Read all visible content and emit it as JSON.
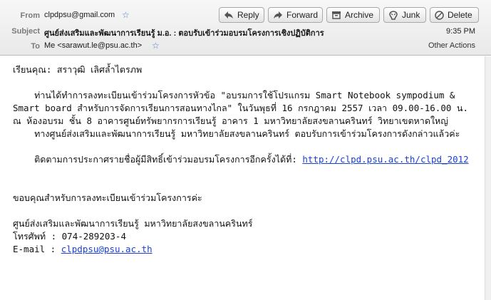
{
  "header": {
    "from_label": "From",
    "from_value": "clpdpsu@gmail.com",
    "subject_label": "Subject",
    "subject_value": "ศูนย์ส่งเสริมและพัฒนาการเรียนรู้ ม.อ. : ตอบรับเข้าร่วมอบรมโครงการเชิงปฏิบัติการ",
    "to_label": "To",
    "to_value": "Me <sarawut.le@psu.ac.th>",
    "time": "9:35 PM",
    "other_actions": "Other Actions"
  },
  "toolbar": {
    "reply": "Reply",
    "forward": "Forward",
    "archive": "Archive",
    "junk": "Junk",
    "delete": "Delete"
  },
  "body": {
    "greeting": "เรียนคุณ: สราวุฒิ เลิศล้ำไตรภพ",
    "para1": "    ท่านได้ทำการลงทะเบียนเข้าร่วมโครงการหัวข้อ \"อบรมการใช้โปรแกรม Smart Notebook sympodium & Smart board สำหรับการจัดการเรียนการสอนทางไกล\" ในวันพุธที่ 16 กรกฎาคม 2557 เวลา 09.00-16.00 น. ณ ห้องอบรม ชั้น 8 อาคารศูนย์ทรัพยากรการเรียนรู้ อาคาร 1 มหาวิทยาลัยสงขลานครินทร์ วิทยาเขตหาดใหญ่",
    "para2": "    ทางศูนย์ส่งเสริมและพัฒนาการเรียนรู้ มหาวิทยาลัยสงขลานครินทร์ ตอบรับการเข้าร่วมโครงการดังกล่าวแล้วค่ะ",
    "follow_text": "    ติดตามการประกาศรายชื่อผู้มีสิทธิ์เข้าร่วมอบรมโครงการอีกครั้งได้ที่: ",
    "follow_link": "http://clpd.psu.ac.th/clpd_2012",
    "thanks": "ขอบคุณสำหรับการลงทะเบียนเข้าร่วมโครงการค่ะ",
    "sig_org": "ศูนย์ส่งเสริมและพัฒนาการเรียนรู้ มหาวิทยาลัยสงขลานครินทร์",
    "sig_phone": "โทรศัพท์ : 074-289203-4",
    "sig_email_label": "E-mail : ",
    "sig_email": "clpdpsu@psu.ac.th"
  },
  "colors": {
    "accent": "#4a7cc9",
    "link": "#1a3fd6"
  },
  "icons": [
    "star-icon",
    "reply-icon",
    "forward-icon",
    "archive-icon",
    "junk-icon",
    "delete-icon"
  ]
}
